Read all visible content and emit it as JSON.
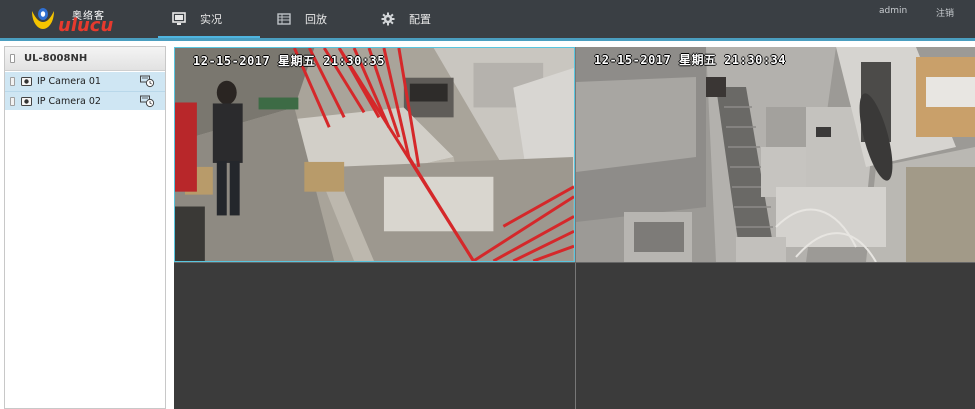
{
  "header": {
    "logo": {
      "cn": "奥络客",
      "en": "ulucu"
    },
    "tabs": [
      {
        "label": "实况",
        "icon": "monitor-icon",
        "active": true
      },
      {
        "label": "回放",
        "icon": "playback-icon",
        "active": false
      },
      {
        "label": "配置",
        "icon": "gear-icon",
        "active": false
      }
    ],
    "user": "admin",
    "logout": "注销",
    "colors": {
      "bar": "#3a3f44",
      "accent": "#4fb5e0"
    }
  },
  "sidebar": {
    "device": {
      "name": "UL-8008NH",
      "icon": "nvr-device-icon"
    },
    "cameras": [
      {
        "label": "IP Camera 01",
        "icon": "camera-icon",
        "action_icon": "record-status-icon"
      },
      {
        "label": "IP Camera 02",
        "icon": "camera-icon",
        "action_icon": "record-status-icon"
      }
    ]
  },
  "video": {
    "layout": "2x2",
    "selected_cell": 1,
    "cells": [
      {
        "osd": "12-15-2017  星期五  21:30:35",
        "has_feed": true
      },
      {
        "osd": "12-15-2017  星期五  21:30:34",
        "has_feed": true
      },
      {
        "osd": "",
        "has_feed": false
      },
      {
        "osd": "",
        "has_feed": false
      }
    ]
  }
}
